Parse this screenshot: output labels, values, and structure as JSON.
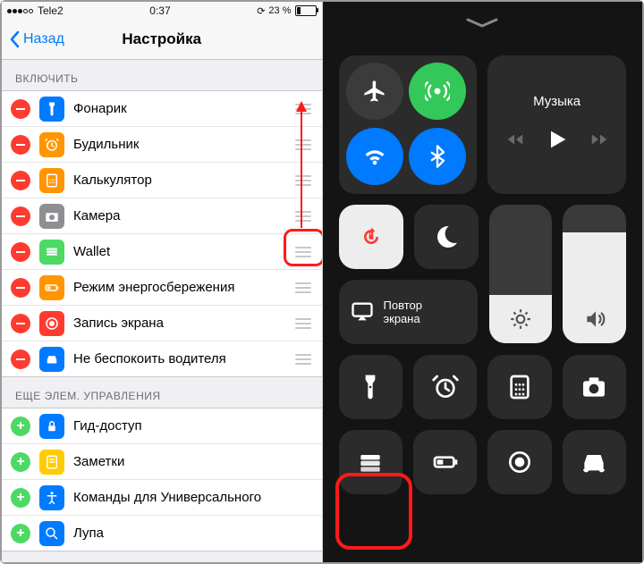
{
  "status": {
    "carrier": "Tele2",
    "time": "0:37",
    "battery_pct": "23 %"
  },
  "nav": {
    "back_label": "Назад",
    "title": "Настройка"
  },
  "section_include": "ВКЛЮЧИТЬ",
  "include_items": [
    {
      "label": "Фонарик",
      "icon": "flashlight",
      "color": "ic-blue"
    },
    {
      "label": "Будильник",
      "icon": "alarm",
      "color": "ic-orange"
    },
    {
      "label": "Калькулятор",
      "icon": "calc",
      "color": "ic-orange2"
    },
    {
      "label": "Камера",
      "icon": "camera",
      "color": "ic-gray"
    },
    {
      "label": "Wallet",
      "icon": "wallet",
      "color": "ic-green"
    },
    {
      "label": "Режим энергосбережения",
      "icon": "battery",
      "color": "ic-orange"
    },
    {
      "label": "Запись экрана",
      "icon": "record",
      "color": "ic-red"
    },
    {
      "label": "Не беспокоить водителя",
      "icon": "car",
      "color": "ic-blue"
    }
  ],
  "section_more": "ЕЩЕ ЭЛЕМ. УПРАВЛЕНИЯ",
  "more_items": [
    {
      "label": "Гид-доступ",
      "icon": "lock",
      "color": "ic-blue"
    },
    {
      "label": "Заметки",
      "icon": "notes",
      "color": "ic-yellow"
    },
    {
      "label": "Команды для Универсального",
      "icon": "access",
      "color": "ic-blue"
    },
    {
      "label": "Лупа",
      "icon": "magnify",
      "color": "ic-blue"
    }
  ],
  "cc": {
    "music_label": "Музыка",
    "mirror_line1": "Повтор",
    "mirror_line2": "экрана",
    "brightness_pct": 35,
    "volume_pct": 80
  }
}
